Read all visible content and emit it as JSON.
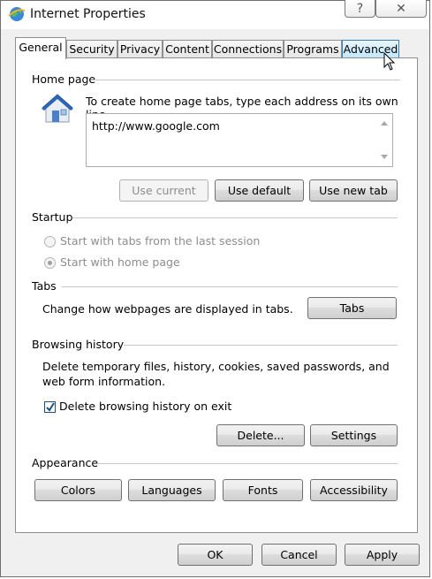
{
  "window": {
    "title": "Internet Properties",
    "help_icon": "?",
    "close_icon": "✕"
  },
  "tabs": [
    {
      "label": "General"
    },
    {
      "label": "Security"
    },
    {
      "label": "Privacy"
    },
    {
      "label": "Content"
    },
    {
      "label": "Connections"
    },
    {
      "label": "Programs"
    },
    {
      "label": "Advanced"
    }
  ],
  "home_page": {
    "heading": "Home page",
    "instruction": "To create home page tabs, type each address on its own line.",
    "url_value": "http://www.google.com",
    "buttons": {
      "use_current": "Use current",
      "use_default": "Use default",
      "use_new_tab": "Use new tab"
    }
  },
  "startup": {
    "heading": "Startup",
    "option_last_session": "Start with tabs from the last session",
    "option_home_page": "Start with home page"
  },
  "tabs_section": {
    "heading": "Tabs",
    "description": "Change how webpages are displayed in tabs.",
    "button": "Tabs"
  },
  "browsing_history": {
    "heading": "Browsing history",
    "description_line1": "Delete temporary files, history, cookies, saved passwords, and",
    "description_line2": "web form information.",
    "checkbox_label": "Delete browsing history on exit",
    "checkbox_checked": true,
    "delete_button": "Delete...",
    "settings_button": "Settings"
  },
  "appearance": {
    "heading": "Appearance",
    "buttons": {
      "colors": "Colors",
      "languages": "Languages",
      "fonts": "Fonts",
      "accessibility": "Accessibility"
    }
  },
  "footer": {
    "ok": "OK",
    "cancel": "Cancel",
    "apply": "Apply"
  },
  "colors": {
    "check_mark": "#1c5180",
    "tab_hover": "#bee6fd"
  }
}
